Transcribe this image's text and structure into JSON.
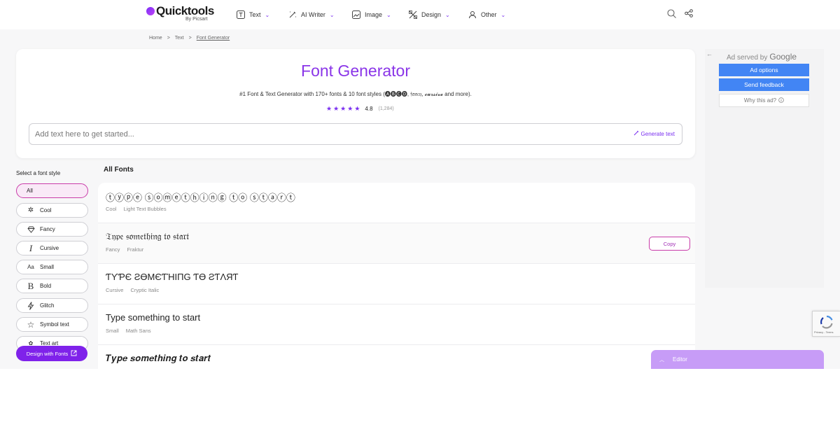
{
  "header": {
    "logo_text": "Quicktools",
    "logo_sub": "By Picsart",
    "nav": [
      {
        "label": "Text",
        "icon": "text-icon"
      },
      {
        "label": "AI Writer",
        "icon": "ai-writer-icon"
      },
      {
        "label": "Image",
        "icon": "image-icon"
      },
      {
        "label": "Design",
        "icon": "design-icon"
      },
      {
        "label": "Other",
        "icon": "other-icon"
      }
    ],
    "chevron": "⌄"
  },
  "breadcrumb": {
    "home": "Home",
    "sep1": ">",
    "text": "Text",
    "sep2": ">",
    "current": "Font Generator"
  },
  "hero": {
    "title": "Font Generator",
    "subtitle": "#1 Font & Text Generator with 170+ fonts & 10 font styles (🅐🅑🅒🅓, 𝔣𝔞𝔫𝔠𝔶, 𝓬𝓾𝓻𝓼𝓲𝓿𝓮 and more).",
    "rating_value": "4.8",
    "rating_count": "(1,284)",
    "stars": 5,
    "input_placeholder": "Add text here to get started...",
    "generate_label": "Generate text"
  },
  "sidebar": {
    "label": "Select a font style",
    "items": [
      {
        "label": "All",
        "icon": "",
        "active": true
      },
      {
        "label": "Cool",
        "icon": "sparkle-icon"
      },
      {
        "label": "Fancy",
        "icon": "diamond-icon"
      },
      {
        "label": "Cursive",
        "icon": "cursive-i-icon"
      },
      {
        "label": "Small",
        "icon": "small-aa-icon"
      },
      {
        "label": "Bold",
        "icon": "bold-b-icon"
      },
      {
        "label": "Glitch",
        "icon": "glitch-bolt-icon"
      },
      {
        "label": "Symbol text",
        "icon": "star-icon"
      },
      {
        "label": "Text art",
        "icon": "text-art-icon"
      }
    ],
    "design_button": "Design with Fonts"
  },
  "fonts": {
    "heading": "All Fonts",
    "copy_label": "Copy",
    "rows": [
      {
        "sample": "ⓣⓨⓟⓔ ⓢⓞⓜⓔⓣⓗⓘⓝⓖ ⓣⓞ ⓢⓣⓐⓡⓣ",
        "category": "Cool",
        "name": "Light Text Bubbles"
      },
      {
        "sample": "𝔗𝔶𝔭𝔢 𝔰𝔬𝔪𝔢𝔱𝔥𝔦𝔫𝔤 𝔱𝔬 𝔰𝔱𝔞𝔯𝔱",
        "category": "Fancy",
        "name": "Fraktur"
      },
      {
        "sample": "ƬƳƤЄ ƧӨMЄƬΉIПG ƬӨ ƧƬΛЯƬ",
        "category": "Cursive",
        "name": "Cryptic Italic"
      },
      {
        "sample": "Type something to start",
        "category": "Small",
        "name": "Math Sans"
      },
      {
        "sample": "𝑻𝒚𝒑𝒆 𝒔𝒐𝒎𝒆𝒕𝒉𝒊𝒏𝒈 𝒕𝒐 𝒔𝒕𝒂𝒓𝒕",
        "category": "",
        "name": ""
      }
    ]
  },
  "ad": {
    "served_by": "Ad served by",
    "google": "Google",
    "options": "Ad options",
    "feedback": "Send feedback",
    "why": "Why this ad?"
  },
  "recaptcha": {
    "text": "Privacy - Terms"
  },
  "editor": {
    "label": "Editor"
  },
  "colors": {
    "accent": "#7a2ff0",
    "title": "#8a35e8",
    "pink": "#c93ca9",
    "ad_blue": "#4285f4"
  }
}
